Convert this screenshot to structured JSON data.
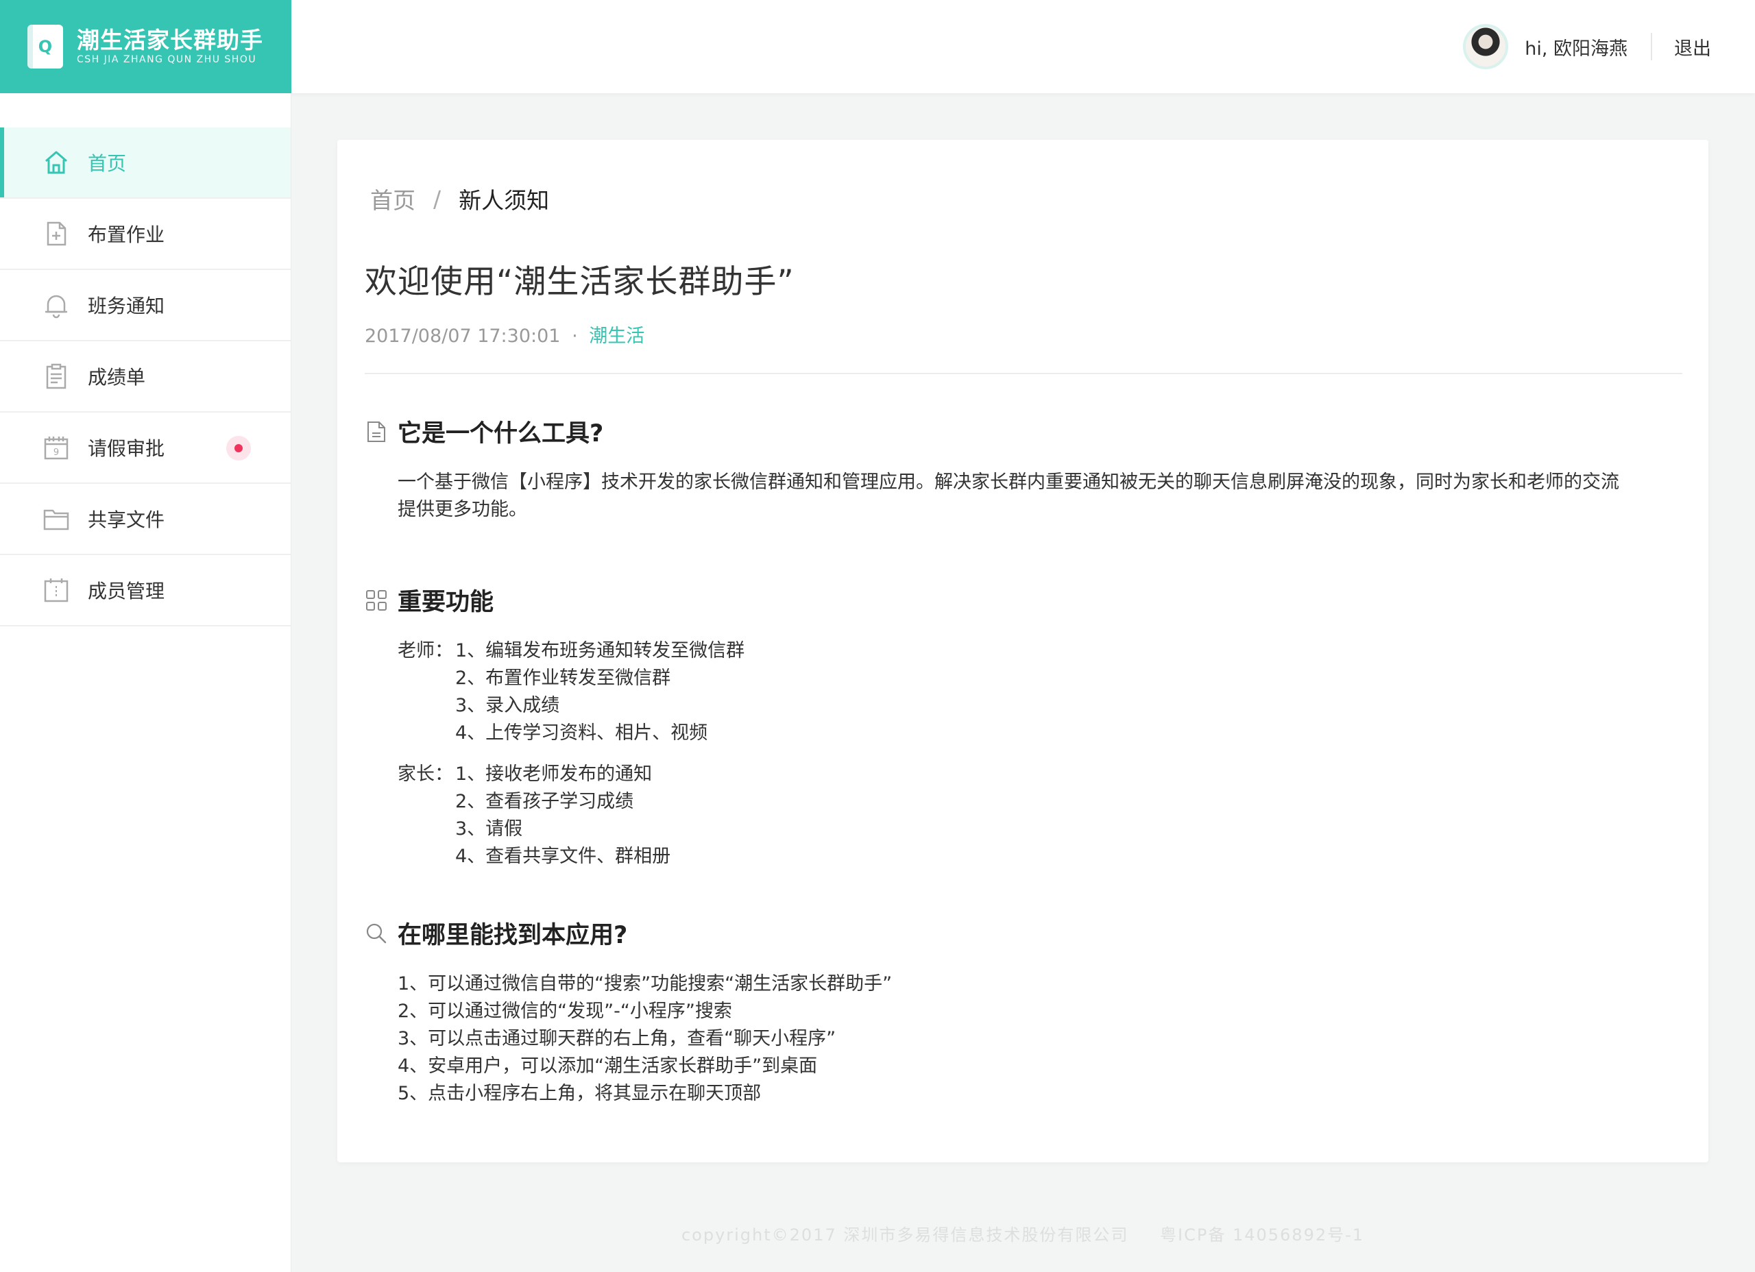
{
  "brand": {
    "title": "潮生活家长群助手",
    "subtitle": "CSH JIA ZHANG QUN ZHU SHOU",
    "logo_letter": "Q",
    "color": "#36c4b3"
  },
  "header": {
    "greeting": "hi, 欧阳海燕",
    "logout_label": "退出"
  },
  "sidebar": {
    "items": [
      {
        "label": "首页",
        "icon": "home-icon",
        "active": true
      },
      {
        "label": "布置作业",
        "icon": "file-add-icon",
        "active": false
      },
      {
        "label": "班务通知",
        "icon": "bell-icon",
        "active": false
      },
      {
        "label": "成绩单",
        "icon": "clipboard-icon",
        "active": false
      },
      {
        "label": "请假审批",
        "icon": "calendar-icon",
        "active": false,
        "badge": true
      },
      {
        "label": "共享文件",
        "icon": "folder-icon",
        "active": false
      },
      {
        "label": "成员管理",
        "icon": "members-icon",
        "active": false
      }
    ]
  },
  "breadcrumb": {
    "home": "首页",
    "separator": "/",
    "current": "新人须知"
  },
  "article": {
    "title": "欢迎使用“潮生活家长群助手”",
    "datetime": "2017/08/07 17:30:01",
    "dot": "·",
    "source": "潮生活",
    "sections": {
      "what": {
        "title": "它是一个什么工具?",
        "icon": "document-icon",
        "lines": [
          "一个基于微信【小程序】技术开发的家长微信群通知和管理应用。解决家长群内重要通知被无关的聊天信息刷屏淹没的现象，同时为家长和老师的交流",
          "提供更多功能。"
        ]
      },
      "features": {
        "title": "重要功能",
        "icon": "grid-icon",
        "teacher_label": "老师：",
        "teacher_items": [
          "1、编辑发布班务通知转发至微信群",
          "2、布置作业转发至微信群",
          "3、录入成绩",
          "4、上传学习资料、相片、视频"
        ],
        "parent_label": "家长：",
        "parent_items": [
          "1、接收老师发布的通知",
          "2、查看孩子学习成绩",
          "3、请假",
          "4、查看共享文件、群相册"
        ]
      },
      "where": {
        "title": "在哪里能找到本应用?",
        "icon": "search-icon",
        "items": [
          "1、可以通过微信自带的“搜索”功能搜索“潮生活家长群助手”",
          "2、可以通过微信的“发现”-“小程序”搜索",
          "3、可以点击通过聊天群的右上角，查看“聊天小程序”",
          "4、安卓用户，可以添加“潮生活家长群助手”到桌面",
          "5、点击小程序右上角，将其显示在聊天顶部"
        ]
      }
    }
  },
  "footer": {
    "copyright": "copyright©2017 深圳市多易得信息技术股份有限公司",
    "icp": "粤ICP备 14056892号-1"
  }
}
